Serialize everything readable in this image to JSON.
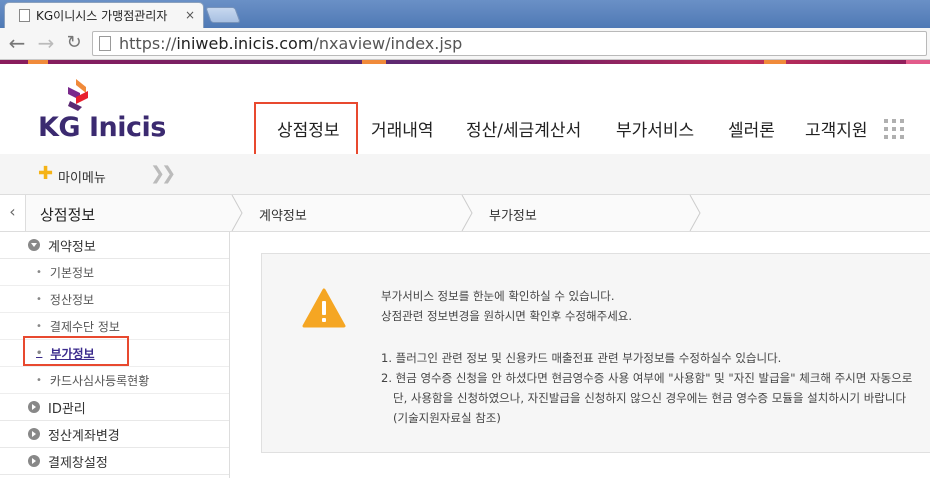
{
  "browser": {
    "tab_title": "KG이니시스 가맹점관리자",
    "tab_close": "×",
    "url_scheme": "https://",
    "url_host": "iniweb.inicis.com",
    "url_path": "/nxaview/index.jsp"
  },
  "brand": {
    "logo_text": "KG Inicis",
    "colors": {
      "primary": "#3b2a70",
      "accent": "#f5b316",
      "highlight": "#e8492f",
      "logo_red": "#e8212d",
      "logo_purple": "#7a2a8c"
    }
  },
  "gnb": {
    "items": [
      "상점정보",
      "거래내역",
      "정산/세금계산서",
      "부가서비스",
      "셀러론",
      "고객지원"
    ]
  },
  "mymenu": {
    "label": "마이메뉴"
  },
  "breadcrumb": {
    "title": "상점정보",
    "crumbs": [
      "계약정보",
      "부가정보"
    ]
  },
  "sidebar": {
    "group_contract": "계약정보",
    "sub": [
      "기본정보",
      "정산정보",
      "결제수단 정보",
      "부가정보",
      "카드사심사등록현황"
    ],
    "group_id": "ID관리",
    "group_account": "정산계좌변경",
    "group_window": "결제창설정"
  },
  "notice": {
    "line1": "부가서비스 정보를 한눈에 확인하실 수 있습니다.",
    "line2": "상점관련 정보변경을 원하시면 확인후 수정해주세요.",
    "item1": "1. 플러그인 관련 정보 및 신용카드 매출전표 관련 부가정보를 수정하실수 있습니다.",
    "item2": "2. 현금 영수증 신청을 안 하셨다면 현금영수증 사용 여부에 \"사용함\" 및 \"자진 발급을\" 체크해 주시면 자동으로",
    "item2b": "단, 사용함을 신청하였으나, 자진발급을 신청하지 않으신 경우에는 현금 영수증 모듈을 설치하시기 바랍니다",
    "item2c": "(기술지원자료실 참조)"
  }
}
